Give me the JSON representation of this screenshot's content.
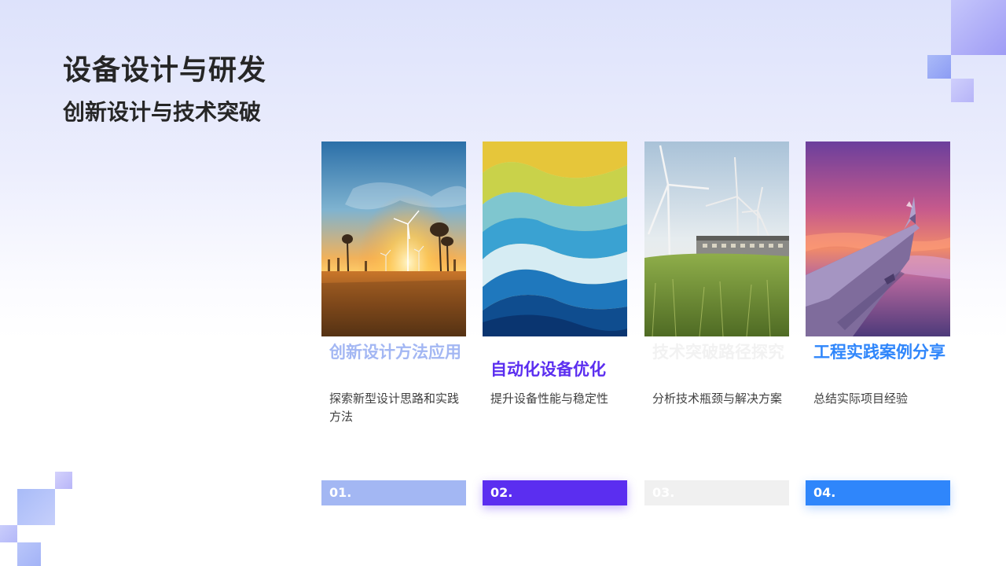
{
  "page": {
    "title": "设备设计与研发",
    "subtitle": "创新设计与技术突破"
  },
  "cards": [
    {
      "title": "创新设计方法应用",
      "description": "探索新型设计思路和实践方法",
      "number": "01.",
      "accent_color": "#a3b7f3",
      "image": "wind-turbines-sunset"
    },
    {
      "title": "自动化设备优化",
      "description": "提升设备性能与稳定性",
      "number": "02.",
      "accent_color": "#5b2ef0",
      "image": "abstract-waves"
    },
    {
      "title": "技术突破路径探究",
      "description": "分析技术瓶颈与解决方案",
      "number": "03.",
      "accent_color": "#f0f0f0",
      "image": "wind-turbines-building"
    },
    {
      "title": "工程实践案例分享",
      "description": "总结实际项目经验",
      "number": "04.",
      "accent_color": "#2f86fb",
      "image": "airplane-wing-sunset"
    }
  ]
}
